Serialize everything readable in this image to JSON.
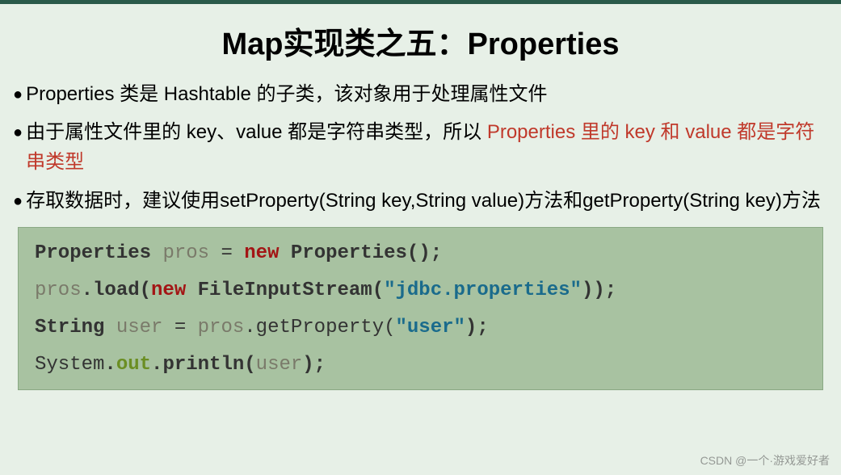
{
  "title": "Map实现类之五：Properties",
  "bullets": [
    {
      "plain": "Properties 类是 Hashtable 的子类，该对象用于处理属性文件"
    },
    {
      "segments": [
        {
          "t": "由于属性文件里的 key、value 都是字符串类型，所以 ",
          "cls": ""
        },
        {
          "t": "Properties 里的 key 和 value 都是字符串类型",
          "cls": "red"
        }
      ]
    },
    {
      "plain": "存取数据时，建议使用setProperty(String key,String value)方法和getProperty(String key)方法"
    }
  ],
  "code": {
    "line1": {
      "type": "Properties",
      "var": "pros",
      "eq": " = ",
      "kw": "new",
      "ctor": " Properties();"
    },
    "line2": {
      "obj": "pros",
      "dot1": ".",
      "method": "load(",
      "kw": "new",
      "cls": " FileInputStream(",
      "str": "\"jdbc.properties\"",
      "close": "));"
    },
    "line3": {
      "type": "String",
      "var": "user",
      "eq": " = ",
      "obj": "pros",
      "rest": ".getProperty(",
      "str": "\"user\"",
      "close": ");"
    },
    "line4": {
      "sys": "System",
      "dot": ".",
      "out": "out",
      "dot2": ".",
      "method": "println(",
      "arg": "user",
      "close": ");"
    }
  },
  "watermark": "CSDN @一个·游戏爱好者"
}
